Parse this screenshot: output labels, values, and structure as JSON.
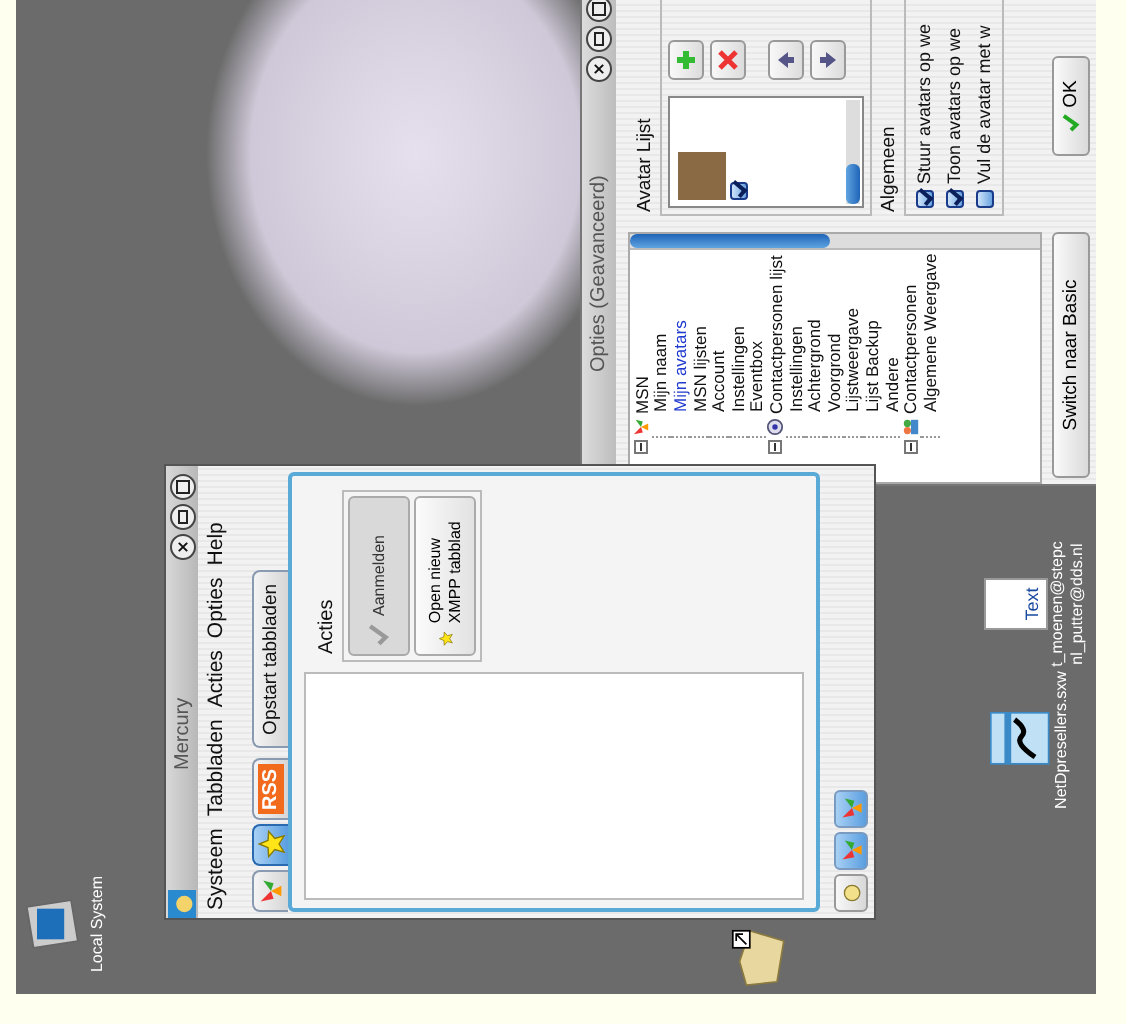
{
  "desktop_icons": [
    {
      "kind": "computer",
      "label_lines": [
        "Local System"
      ]
    },
    {
      "kind": "shortcut"
    },
    {
      "kind": "document",
      "label_lines": [
        "NetDpresellers.sxw"
      ]
    },
    {
      "kind": "text-file",
      "badge": "Text",
      "label_lines": [
        "t_moenen@stepc",
        "nl_putter@dds.nl"
      ]
    }
  ],
  "mercury_window": {
    "title": "Mercury",
    "menu": [
      "Systeem",
      "Tabbladen",
      "Acties",
      "Opties",
      "Help"
    ],
    "tabs": [
      {
        "kind": "butterfly",
        "selected": false
      },
      {
        "kind": "star",
        "selected": true
      },
      {
        "kind": "rss",
        "label": "RSS",
        "selected": false
      },
      {
        "kind": "text",
        "label": "Opstart tabbladen",
        "selected": false
      }
    ],
    "actions_label": "Acties",
    "action_buttons": [
      {
        "kind": "check",
        "label": "Aanmelden",
        "disabled": true
      },
      {
        "kind": "star",
        "label": "Open nieuw XMPP tabblad",
        "disabled": false
      }
    ],
    "bottom_buttons": [
      {
        "kind": "hand"
      },
      {
        "kind": "butterfly"
      },
      {
        "kind": "butterfly"
      }
    ]
  },
  "options_window": {
    "title": "Opties (Geavanceerd)",
    "tree": [
      {
        "kind": "butterfly",
        "label": "MSN",
        "expanded": true,
        "selected": false,
        "children": [
          {
            "label": "Mijn naam",
            "selected": false
          },
          {
            "label": "Mijn avatars",
            "selected": true
          },
          {
            "label": "MSN lijsten",
            "selected": false
          },
          {
            "label": "Account",
            "selected": false
          },
          {
            "label": "Instellingen",
            "selected": false
          },
          {
            "label": "Eventbox",
            "selected": false
          }
        ]
      },
      {
        "kind": "list",
        "label": "Contactpersonen lijst",
        "expanded": true,
        "selected": false,
        "children": [
          {
            "label": "Instellingen",
            "selected": false
          },
          {
            "label": "Achtergrond",
            "selected": false
          },
          {
            "label": "Voorgrond",
            "selected": false
          },
          {
            "label": "Lijstweergave",
            "selected": false
          },
          {
            "label": "Lijst Backup",
            "selected": false
          },
          {
            "label": "Andere",
            "selected": false
          }
        ]
      },
      {
        "kind": "people",
        "label": "Contactpersonen",
        "expanded": true,
        "selected": false,
        "children": [
          {
            "label": "Algemene Weergave",
            "selected": false
          }
        ]
      }
    ],
    "avatar_list": {
      "title": "Avatar Lijst",
      "items": [
        {
          "checked": true
        }
      ],
      "buttons": [
        {
          "kind": "add"
        },
        {
          "kind": "remove"
        },
        {
          "kind": "up"
        },
        {
          "kind": "down"
        }
      ]
    },
    "general": {
      "title": "Algemeen",
      "options": [
        {
          "label": "Stuur avatars op we",
          "checked": true
        },
        {
          "label": "Toon avatars op we",
          "checked": true
        },
        {
          "label": "Vul de avatar met w",
          "checked": false
        }
      ]
    },
    "ok_button": "OK",
    "switch_button": "Switch naar Basic"
  }
}
